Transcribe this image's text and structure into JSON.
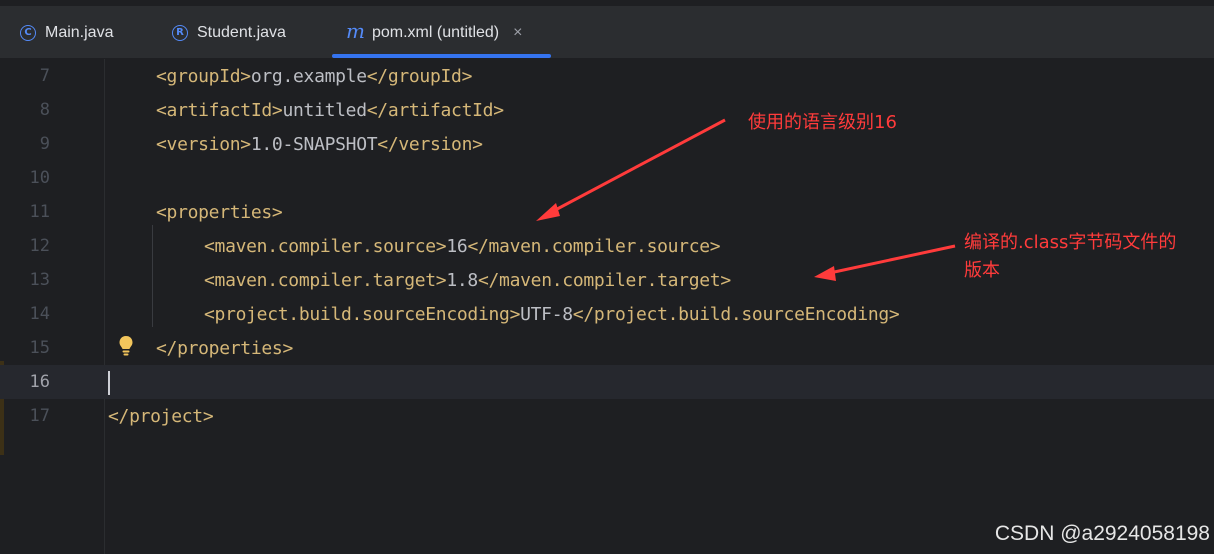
{
  "tabs": [
    {
      "icon": "C",
      "label": "Main.java",
      "active": false
    },
    {
      "icon": "R",
      "label": "Student.java",
      "active": false
    },
    {
      "icon": "m",
      "label": "pom.xml (untitled)",
      "active": true,
      "close": "×"
    }
  ],
  "editor": {
    "lines": [
      {
        "num": "7",
        "segments": [
          [
            "tag",
            "<groupId>"
          ],
          [
            "txt",
            "org.example"
          ],
          [
            "tag",
            "</groupId>"
          ]
        ],
        "indent": 1
      },
      {
        "num": "8",
        "segments": [
          [
            "tag",
            "<artifactId>"
          ],
          [
            "txt",
            "untitled"
          ],
          [
            "tag",
            "</artifactId>"
          ]
        ],
        "indent": 1
      },
      {
        "num": "9",
        "segments": [
          [
            "tag",
            "<version>"
          ],
          [
            "txt",
            "1.0-SNAPSHOT"
          ],
          [
            "tag",
            "</version>"
          ]
        ],
        "indent": 1
      },
      {
        "num": "10",
        "segments": [],
        "indent": 0
      },
      {
        "num": "11",
        "segments": [
          [
            "tag",
            "<properties>"
          ]
        ],
        "indent": 1
      },
      {
        "num": "12",
        "segments": [
          [
            "tag",
            "<maven.compiler.source>"
          ],
          [
            "txt",
            "16"
          ],
          [
            "tag",
            "</maven.compiler.source>"
          ]
        ],
        "indent": 2
      },
      {
        "num": "13",
        "segments": [
          [
            "tag",
            "<maven.compiler.target>"
          ],
          [
            "txt",
            "1.8"
          ],
          [
            "tag",
            "</maven.compiler.target>"
          ]
        ],
        "indent": 2
      },
      {
        "num": "14",
        "segments": [
          [
            "tag",
            "<project.build.sourceEncoding>"
          ],
          [
            "txt",
            "UTF-8"
          ],
          [
            "tag",
            "</project.build.sourceEncoding>"
          ]
        ],
        "indent": 2
      },
      {
        "num": "15",
        "segments": [
          [
            "tag",
            "</properties>"
          ]
        ],
        "indent": 1
      },
      {
        "num": "16",
        "segments": [],
        "indent": 0,
        "current": true
      },
      {
        "num": "17",
        "segments": [
          [
            "tag",
            "</project>"
          ]
        ],
        "indent": 0
      }
    ]
  },
  "annotations": {
    "source_note": "使用的语言级别16",
    "target_note_line1": "编译的.class字节码文件的",
    "target_note_line2": "版本",
    "color": "#ff3b3b"
  },
  "watermark": "CSDN @a2924058198",
  "colors": {
    "accent": "#3574f0",
    "tag": "#d5b778",
    "text": "#bcbec4",
    "background": "#1e1f22"
  }
}
